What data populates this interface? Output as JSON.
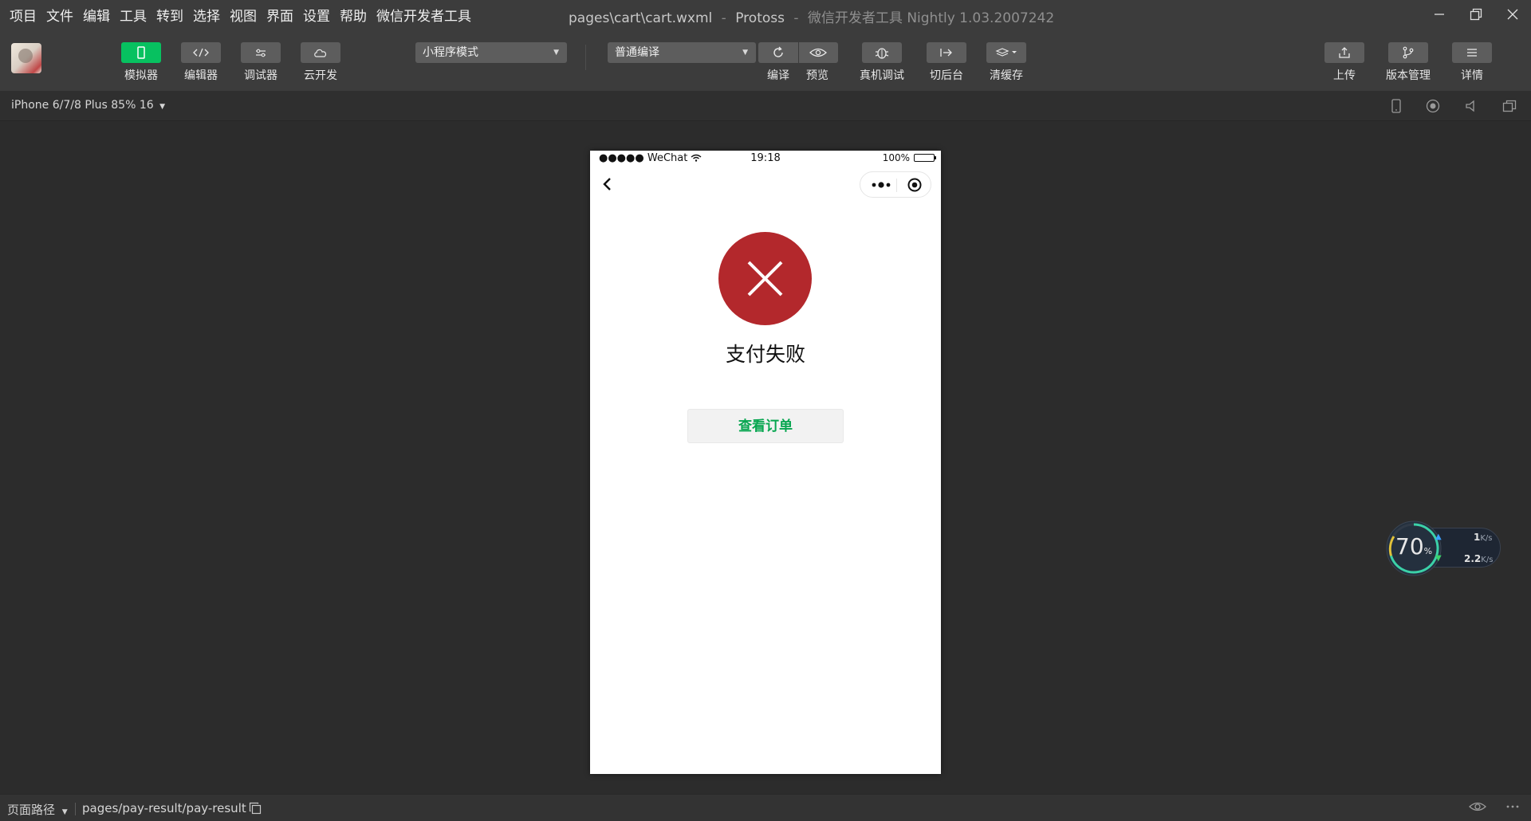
{
  "menu": {
    "items": [
      "项目",
      "文件",
      "编辑",
      "工具",
      "转到",
      "选择",
      "视图",
      "界面",
      "设置",
      "帮助",
      "微信开发者工具"
    ]
  },
  "window": {
    "title": "pages\\cart\\cart.wxml",
    "sep1": "-",
    "project": "Protoss",
    "sep2": "-",
    "app": "微信开发者工具 Nightly 1.03.2007242"
  },
  "toolbar": {
    "simulator": "模拟器",
    "editor": "编辑器",
    "debugger": "调试器",
    "cloud": "云开发",
    "mode_select": "小程序模式",
    "compile_select": "普通编译",
    "compile": "编译",
    "preview": "预览",
    "remote_debug": "真机调试",
    "background": "切后台",
    "clear_cache": "清缓存",
    "upload": "上传",
    "version": "版本管理",
    "details": "详情"
  },
  "device": {
    "name": "iPhone 6/7/8 Plus 85% 16"
  },
  "phone": {
    "carrier": "●●●●● WeChat",
    "time": "19:18",
    "battery": "100%",
    "result_text": "支付失败",
    "view_order_button": "查看订单"
  },
  "network": {
    "percent": "70",
    "percent_unit": "%",
    "upload_value": "1",
    "download_value": "2.2",
    "rate_unit": "K/s"
  },
  "bottom": {
    "path_label": "页面路径",
    "path": "pages/pay-result/pay-result"
  },
  "colors": {
    "accent": "#07c160",
    "fail": "#b3282c"
  }
}
